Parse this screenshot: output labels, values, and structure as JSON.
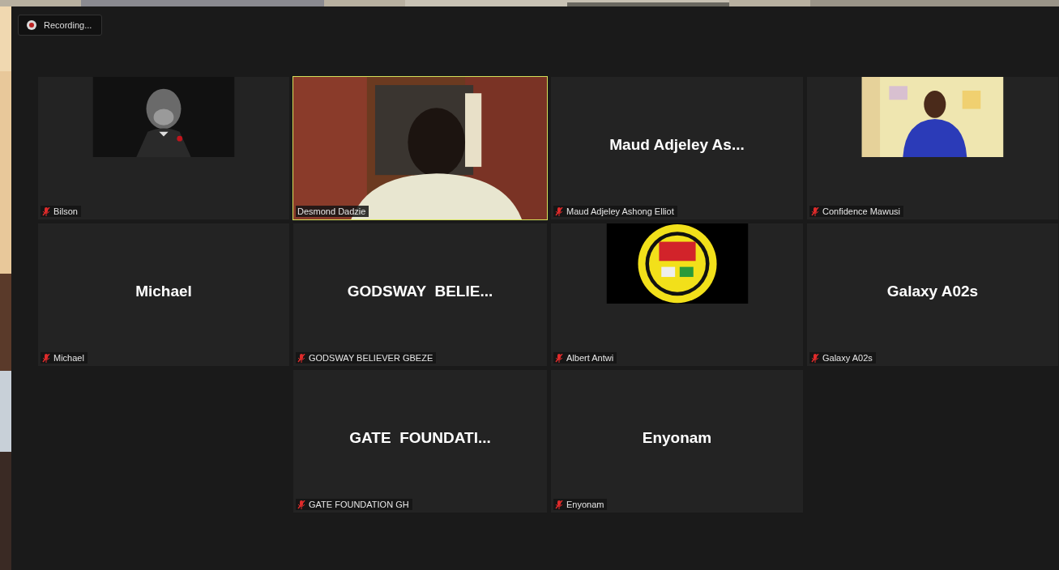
{
  "recording": {
    "label": "Recording..."
  },
  "tiles": [
    {
      "label": "Bilson",
      "muted": true,
      "selected": false
    },
    {
      "kind": "video",
      "label": "Desmond Dadzie",
      "muted": false,
      "selected": true
    },
    {
      "kind": "name",
      "display_name": "Maud Adjeley As...",
      "label": "Maud Adjeley Ashong Elliot",
      "muted": true,
      "selected": false
    },
    {
      "label": "Confidence Mawusi",
      "muted": true,
      "selected": false
    },
    {
      "kind": "name",
      "display_name": "Michael",
      "label": "Michael",
      "muted": true,
      "selected": false
    },
    {
      "kind": "name",
      "display_name": "GODSWAY  BELIE...",
      "label": "GODSWAY BELIEVER GBEZE",
      "muted": true,
      "selected": false
    },
    {
      "label": "Albert Antwi",
      "muted": true,
      "selected": false
    },
    {
      "kind": "name",
      "display_name": "Galaxy A02s",
      "label": "Galaxy A02s",
      "muted": true,
      "selected": false
    },
    {
      "kind": "empty"
    },
    {
      "kind": "name",
      "display_name": "GATE  FOUNDATI...",
      "label": "GATE FOUNDATION GH",
      "muted": true,
      "selected": false
    },
    {
      "kind": "name",
      "display_name": "Enyonam",
      "label": "Enyonam",
      "muted": true,
      "selected": false
    }
  ]
}
